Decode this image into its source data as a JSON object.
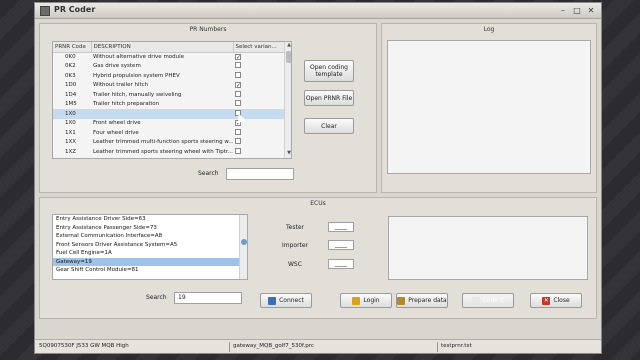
{
  "window": {
    "title": "PR Coder",
    "controls": {
      "minimize": "–",
      "maximize": "□",
      "close": "✕"
    }
  },
  "pr_panel": {
    "title": "PR Numbers",
    "columns": [
      "PRNR Code",
      "DESCRIPTION",
      "Select varian..."
    ],
    "rows": [
      {
        "code": "0K0",
        "description": "Without alternative drive module",
        "checked": true
      },
      {
        "code": "0K2",
        "description": "Gas drive system",
        "checked": false
      },
      {
        "code": "0K3",
        "description": "Hybrid propulsion system PHEV",
        "checked": false
      },
      {
        "code": "1D0",
        "description": "Without trailer hitch",
        "checked": true
      },
      {
        "code": "1D4",
        "description": "Trailer hitch, manually swiveling",
        "checked": false
      },
      {
        "code": "1M5",
        "description": "Trailer hitch preparation",
        "checked": false
      },
      {
        "code": "1X0",
        "description": "",
        "checked": false,
        "selected": true
      },
      {
        "code": "1X0",
        "description": "Front wheel drive",
        "checked": true
      },
      {
        "code": "1X1",
        "description": "Four wheel drive",
        "checked": false
      },
      {
        "code": "1XX",
        "description": "Leather trimmed multi-function sports steering w...",
        "checked": false
      },
      {
        "code": "1XZ",
        "description": "Leather trimmed sports steering wheel with Tiptr...",
        "checked": false
      }
    ],
    "search_label": "Search",
    "search_value": ""
  },
  "actions": {
    "open_template": "Open coding template",
    "open_prnr": "Open PRNR File",
    "clear": "Clear"
  },
  "log_panel": {
    "title": "Log"
  },
  "ecu_panel": {
    "title": "ECUs",
    "items": [
      "Entry Assistance Driver Side=63",
      "Entry Assistance Passenger Side=73",
      "External Communication Interface=A8",
      "Front Sensors Driver Assistance System=A5",
      "Fuel Cell Engine=1A",
      "Gateway=19",
      "Gear Shift Control Module=81"
    ],
    "selected_index": 5,
    "tester_label": "Tester",
    "tester_value": "____",
    "importer_label": "Importer",
    "importer_value": "____",
    "wsc_label": "WSC",
    "wsc_value": "____",
    "search_label": "Search",
    "search_value": "19"
  },
  "buttons": {
    "connect": "Connect",
    "login": "Login",
    "prepare": "Prepare data",
    "code": "Code It",
    "close": "Close"
  },
  "status": {
    "ecu": "5Q0907530F  J533  GW MQB High",
    "file1": "gateway_MQB_golf7_530f.prc",
    "file2": "testprnr.txt"
  },
  "colors": {
    "selection": "#9fc3e7",
    "close_icon": "#c0392b",
    "connect_icon": "#3b6fb6",
    "login_icon": "#d9a21b"
  }
}
